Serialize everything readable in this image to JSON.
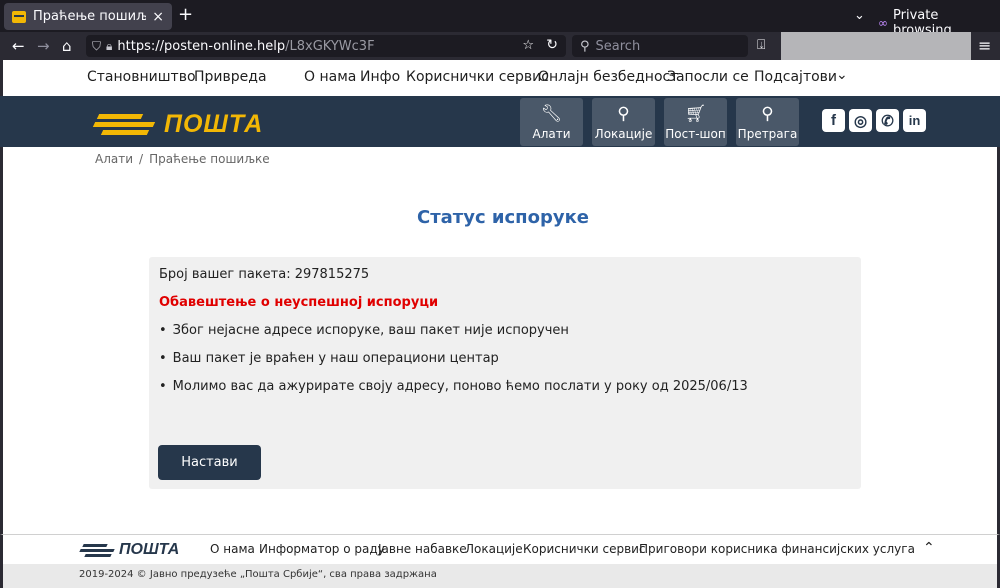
{
  "browser": {
    "tab_title": "Праћење пошиљке",
    "tab_close": "×",
    "new_tab": "+",
    "private_label": "Private browsing",
    "url_host": "https://posten-online.help",
    "url_path": "/L8xGKYWc3F",
    "search_placeholder": "Search"
  },
  "topnav": {
    "items": [
      "Становништво",
      "Привреда",
      "О нама",
      "Инфо",
      "Кориснички сервис",
      "Онлајн безбедност",
      "Запосли се",
      "Подсајтови"
    ]
  },
  "header": {
    "logo_text": "ПОШТА",
    "buttons": [
      {
        "label": "Алати",
        "icon": "wrench-icon"
      },
      {
        "label": "Локације",
        "icon": "map-pin-icon"
      },
      {
        "label": "Пост-шоп",
        "icon": "cart-icon"
      },
      {
        "label": "Претрага",
        "icon": "search-icon"
      }
    ],
    "social": {
      "facebook": "f",
      "instagram": "◎",
      "viber": "✆",
      "linkedin": "in"
    }
  },
  "breadcrumb": {
    "first": "Алати",
    "separator": "/",
    "current": "Праћење пошиљке"
  },
  "status": {
    "title": "Статус испоруке",
    "package_line": "Број вашег пакета: 297815275",
    "alert": "Обавештење о неуспешној испоруци",
    "bullets": [
      "Због нејасне адресе испоруке, ваш пакет није испоручен",
      "Ваш пакет је враћен у наш операциони центар",
      "Молимо вас да ажурирате своју адресу, поново ћемо послати у року од 2025/06/13"
    ],
    "continue_label": "Настави"
  },
  "footer": {
    "logo_text": "ПОШТА",
    "links": [
      "О нама",
      "Информатор о раду",
      "Јавне набавке",
      "Локације",
      "Кориснички сервис",
      "Приговори корисника финансијских услуга"
    ],
    "copyright": "2019-2024 © Јавно предузеће „Пошта Србије“, сва права задржана"
  },
  "colors": {
    "navy": "#26374b",
    "gold": "#f2b705",
    "alert_red": "#e00000",
    "title_blue": "#2e63a8"
  }
}
